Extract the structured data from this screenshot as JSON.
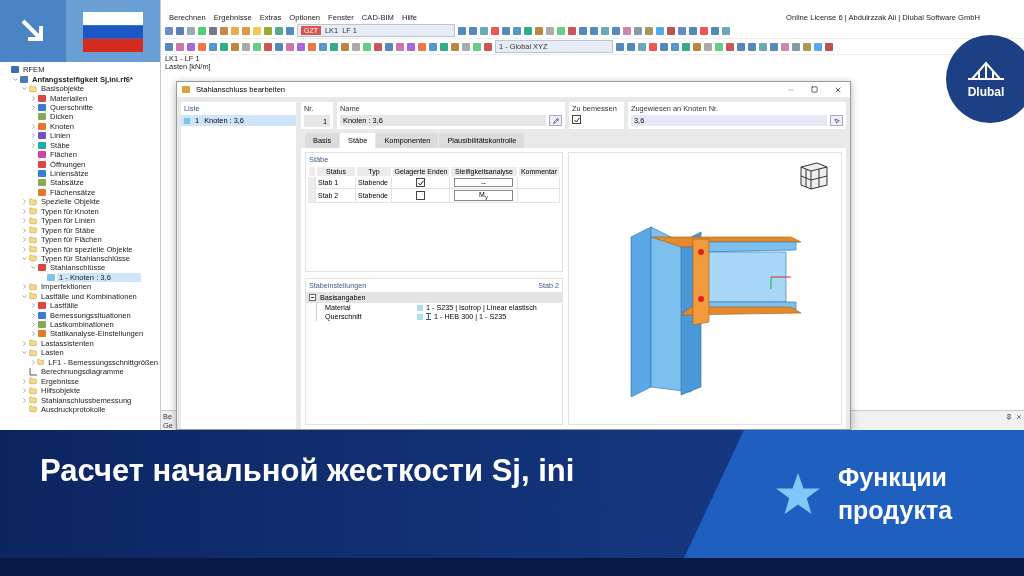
{
  "menu": {
    "items": [
      "Berechnen",
      "Ergebnisse",
      "Extras",
      "Optionen",
      "Fenster",
      "CAD-BIM",
      "Hilfe"
    ],
    "license": "Online License 6 | Abdulrzzak Ali | Dlubal Software GmbH"
  },
  "toolbar": {
    "load_badge": "GZT",
    "load_case": "LK1",
    "load_name": "LF 1",
    "coordinate_system": "1 - Global XYZ"
  },
  "canvas": {
    "labels": [
      "LK1 - LF 1",
      "Lasten [kN/m]"
    ],
    "panel_title": "Be",
    "panel_text": "Ge"
  },
  "logo": {
    "text": "Dlubal"
  },
  "tree": [
    {
      "label": "RFEM",
      "kind": "root",
      "selected": false,
      "children": [
        {
          "label": "Anfangssteifigkeit Sj,ini.rf6*",
          "kind": "file",
          "expanded": true,
          "selected": false,
          "children": [
            {
              "label": "Basisobjekte",
              "kind": "folder",
              "expanded": true,
              "selected": false,
              "children": [
                {
                  "label": "Materialien",
                  "kind": "object",
                  "expanded": false,
                  "selected": false
                },
                {
                  "label": "Querschnitte",
                  "kind": "object",
                  "expanded": false,
                  "selected": false
                },
                {
                  "label": "Dicken",
                  "kind": "object",
                  "selected": false
                },
                {
                  "label": "Knoten",
                  "kind": "object",
                  "expanded": false,
                  "selected": false
                },
                {
                  "label": "Linien",
                  "kind": "object",
                  "expanded": false,
                  "selected": false
                },
                {
                  "label": "Stäbe",
                  "kind": "object",
                  "expanded": false,
                  "selected": false
                },
                {
                  "label": "Flächen",
                  "kind": "object",
                  "selected": false
                },
                {
                  "label": "Öffnungen",
                  "kind": "object",
                  "selected": false
                },
                {
                  "label": "Liniensätze",
                  "kind": "object",
                  "selected": false
                },
                {
                  "label": "Stabsätze",
                  "kind": "object",
                  "selected": false
                },
                {
                  "label": "Flächensätze",
                  "kind": "object",
                  "selected": false
                }
              ]
            },
            {
              "label": "Spezielle Objekte",
              "kind": "folder",
              "expanded": false,
              "selected": false
            },
            {
              "label": "Typen für Knoten",
              "kind": "folder",
              "expanded": false,
              "selected": false
            },
            {
              "label": "Typen für Linien",
              "kind": "folder",
              "expanded": false,
              "selected": false
            },
            {
              "label": "Typen für Stäbe",
              "kind": "folder",
              "expanded": false,
              "selected": false
            },
            {
              "label": "Typen für Flächen",
              "kind": "folder",
              "expanded": false,
              "selected": false
            },
            {
              "label": "Typen für spezielle Objekte",
              "kind": "folder",
              "expanded": false,
              "selected": false
            },
            {
              "label": "Typen für Stahlanschlüsse",
              "kind": "folder",
              "expanded": true,
              "selected": false,
              "children": [
                {
                  "label": "Stahlanschlüsse",
                  "kind": "object",
                  "expanded": true,
                  "selected": false,
                  "children": [
                    {
                      "label": "1 - Knoten : 3,6",
                      "kind": "entry",
                      "selected": true
                    }
                  ]
                }
              ]
            },
            {
              "label": "Imperfektionen",
              "kind": "folder",
              "expanded": false,
              "selected": false
            },
            {
              "label": "Lastfälle und Kombinationen",
              "kind": "folder",
              "expanded": true,
              "selected": false,
              "children": [
                {
                  "label": "Lastfälle",
                  "kind": "object",
                  "expanded": false,
                  "selected": false
                },
                {
                  "label": "Bemessungssituationen",
                  "kind": "object",
                  "expanded": false,
                  "selected": false
                },
                {
                  "label": "Lastkombinationen",
                  "kind": "object",
                  "expanded": false,
                  "selected": false
                },
                {
                  "label": "Statikanalyse-Einstellungen",
                  "kind": "object",
                  "expanded": false,
                  "selected": false
                }
              ]
            },
            {
              "label": "Lastassistenten",
              "kind": "folder",
              "expanded": false,
              "selected": false
            },
            {
              "label": "Lasten",
              "kind": "folder",
              "expanded": true,
              "selected": false,
              "children": [
                {
                  "label": "LF1 - Bemessungsschnittgrößen",
                  "kind": "folder",
                  "expanded": false,
                  "selected": false
                }
              ]
            },
            {
              "label": "Berechnungsdiagramme",
              "kind": "diagram",
              "selected": false
            },
            {
              "label": "Ergebnisse",
              "kind": "folder",
              "expanded": false,
              "selected": false
            },
            {
              "label": "Hilfsobjekte",
              "kind": "folder",
              "expanded": false,
              "selected": false
            },
            {
              "label": "Stahlanschlussbemessung",
              "kind": "folder",
              "expanded": false,
              "selected": false
            },
            {
              "label": "Ausdruckprotokolle",
              "kind": "folder",
              "selected": false
            }
          ]
        }
      ]
    }
  ],
  "dialog": {
    "title": "Stahlanschluss bearbeiten",
    "list": {
      "title": "Liste",
      "items": [
        {
          "number": "1",
          "label": "Knoten : 3,6",
          "selected": true
        }
      ]
    },
    "fields": {
      "nr_label": "Nr.",
      "nr_value": "1",
      "name_label": "Name",
      "name_value": "Knoten : 3,6",
      "design_label": "Zu bemessen",
      "design_checked": true,
      "assigned_label": "Zugewiesen an Knoten Nr.",
      "assigned_value": "3,6"
    },
    "tabs": [
      {
        "label": "Basis",
        "selected": false
      },
      {
        "label": "Stäbe",
        "selected": true
      },
      {
        "label": "Komponenten",
        "selected": false
      },
      {
        "label": "Plausibilitätskontrolle",
        "selected": false
      }
    ],
    "members": {
      "title": "Stäbe",
      "columns": [
        "Status",
        "Typ",
        "Gelagerte Enden",
        "Steifigkeitsanalyse",
        "Kommentar"
      ],
      "rows": [
        {
          "name": "Stab 1",
          "type": "Stabende",
          "supported": true,
          "analysis": "--"
        },
        {
          "name": "Stab 2",
          "type": "Stabende",
          "supported": false,
          "analysis": "M$_{y}$"
        }
      ]
    },
    "settings": {
      "title": "Stabeinstellungen",
      "member": "Stab 2",
      "group": "Basisangaben",
      "expanded": true,
      "rows": [
        {
          "label": "Material",
          "value": "1 - S235 | Isotrop | Linear elastisch",
          "kind": "material"
        },
        {
          "label": "Querschnitt",
          "value": "1 - HEB 300 | 1 - S235",
          "kind": "section"
        }
      ]
    }
  },
  "banner": {
    "title": "Расчет начальной жесткости Sj, ini",
    "badge": "Функции продукта"
  }
}
